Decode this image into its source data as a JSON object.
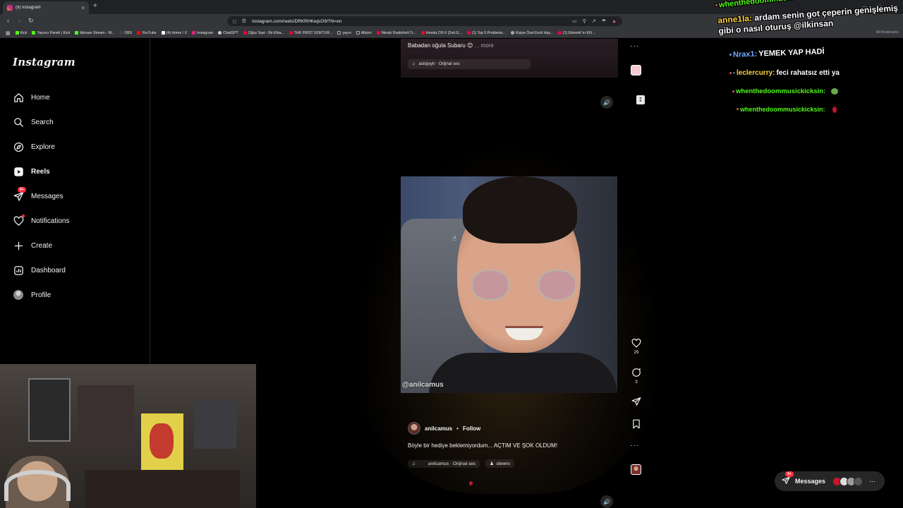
{
  "browser": {
    "tab_title": "(9) Instagram",
    "url": "instagram.com/reels/DRKRHKwjsO9/?hl=en",
    "all_bookmarks": "All Bookmarks",
    "bookmarks": [
      {
        "label": "Kick",
        "color": "#53fc18"
      },
      {
        "label": "Yayıncı Paneli | Kick",
        "color": "#53fc18"
      },
      {
        "label": "ilkinsan Stream - W...",
        "color": "#53fc18"
      },
      {
        "label": "OBS",
        "color": "#444444"
      },
      {
        "label": "YouTube",
        "color": "#ff0000"
      },
      {
        "label": "(4) Home / X",
        "color": "#ffffff"
      },
      {
        "label": "Instagram",
        "color": "#d62976"
      },
      {
        "label": "ChatGPT",
        "color": "#cccccc"
      },
      {
        "label": "Oğuz Sasi - Bir Efsa...",
        "color": "#ff0033"
      },
      {
        "label": "THE FIRST GOKTUR...",
        "color": "#ff0033"
      },
      {
        "label": "yayın",
        "color": "#888888"
      },
      {
        "label": "Albüm",
        "color": "#888888"
      },
      {
        "label": "Merab Dvalishvili Tr...",
        "color": "#ff0033"
      },
      {
        "label": "Honda CR-V (2nd G...",
        "color": "#ff0033"
      },
      {
        "label": "(1) Top 5 Problems...",
        "color": "#ff0033"
      },
      {
        "label": "Kişiye Özel Evcil Hay...",
        "color": "#aaaaaa"
      },
      {
        "label": "(1) Edremit' in EN ...",
        "color": "#ff0033"
      }
    ]
  },
  "sidebar": {
    "logo": "Instagram",
    "messages_badge": "9+",
    "items": [
      {
        "label": "Home",
        "icon": "home-icon"
      },
      {
        "label": "Search",
        "icon": "search-icon"
      },
      {
        "label": "Explore",
        "icon": "explore-icon"
      },
      {
        "label": "Reels",
        "icon": "reels-icon"
      },
      {
        "label": "Messages",
        "icon": "messages-icon"
      },
      {
        "label": "Notifications",
        "icon": "heart-icon"
      },
      {
        "label": "Create",
        "icon": "plus-icon"
      },
      {
        "label": "Dashboard",
        "icon": "dashboard-icon"
      },
      {
        "label": "Profile",
        "icon": "avatar"
      }
    ]
  },
  "reel_top": {
    "caption": "Babadan oğula Subaru 😊",
    "more": "... more",
    "audio": "autojoytr · Orijinal ses"
  },
  "reel": {
    "watermark": "@anilcamus",
    "author": "anilcamus",
    "separator": "•",
    "follow": "Follow",
    "caption": "Böyle bir hediye beklemiyordum... AÇTIM VE ŞOK OLDUM!",
    "audio": "anilcamus · Orijinal ses",
    "tagged_user": "diewro",
    "likes": "29",
    "comments": "3"
  },
  "messages_pill": {
    "label": "Messages",
    "badge": "9+"
  },
  "chat": [
    {
      "user": "whenthedoommusickicksin:",
      "msg": "",
      "color": "#53fc18"
    },
    {
      "user": "anne1la:",
      "msg": "ardam senin got çeperin genişlemiş gibi o nasıl oturuş @ilkinsan",
      "color": "#ffd23f"
    },
    {
      "user": "Nrax1:",
      "msg": "YEMEK YAP HADİ",
      "color": "#6aa8ff"
    },
    {
      "user": "leclercurry:",
      "msg": "feci rahatsız etti ya",
      "color": "#ffd23f"
    },
    {
      "user": "whenthedoommusickicksin:",
      "msg": "",
      "color": "#53fc18"
    },
    {
      "user": "whenthedoommusickicksin:",
      "msg": "",
      "color": "#53fc18"
    }
  ]
}
